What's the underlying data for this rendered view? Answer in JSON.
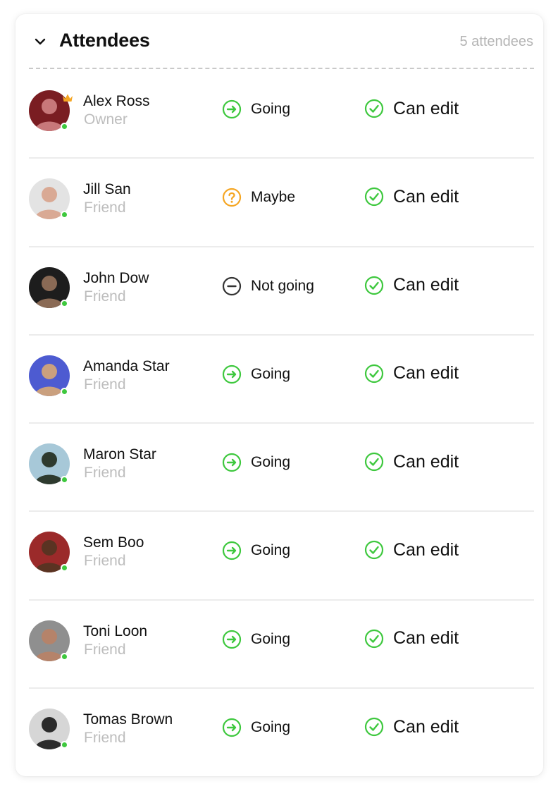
{
  "header": {
    "title": "Attendees",
    "count_label": "5 attendees"
  },
  "colors": {
    "going": "#3ec83e",
    "maybe": "#f5a623",
    "not_going": "#333333",
    "online": "#3ec83e"
  },
  "attendees": [
    {
      "name": "Alex Ross",
      "role": "Owner",
      "status": "Going",
      "status_icon": "arrow-right-circle-icon",
      "permission": "Can edit",
      "owner": true,
      "avatar_colors": [
        "#7a1d22",
        "#c8787a"
      ]
    },
    {
      "name": "Jill San",
      "role": "Friend",
      "status": "Maybe",
      "status_icon": "question-circle-icon",
      "permission": "Can edit",
      "owner": false,
      "avatar_colors": [
        "#e3e3e3",
        "#d9a994"
      ]
    },
    {
      "name": "John Dow",
      "role": "Friend",
      "status": "Not going",
      "status_icon": "minus-circle-icon",
      "permission": "Can edit",
      "owner": false,
      "avatar_colors": [
        "#1d1d1d",
        "#8a6a55"
      ]
    },
    {
      "name": "Amanda Star",
      "role": "Friend",
      "status": "Going",
      "status_icon": "arrow-right-circle-icon",
      "permission": "Can edit",
      "owner": false,
      "avatar_colors": [
        "#4d5bd1",
        "#caa07e"
      ]
    },
    {
      "name": "Maron Star",
      "role": "Friend",
      "status": "Going",
      "status_icon": "arrow-right-circle-icon",
      "permission": "Can edit",
      "owner": false,
      "avatar_colors": [
        "#a7c8d8",
        "#2e3a2e"
      ]
    },
    {
      "name": "Sem Boo",
      "role": "Friend",
      "status": "Going",
      "status_icon": "arrow-right-circle-icon",
      "permission": "Can edit",
      "owner": false,
      "avatar_colors": [
        "#9b2a2a",
        "#5a3322"
      ]
    },
    {
      "name": "Toni Loon",
      "role": "Friend",
      "status": "Going",
      "status_icon": "arrow-right-circle-icon",
      "permission": "Can edit",
      "owner": false,
      "avatar_colors": [
        "#8f8f8f",
        "#b5836a"
      ]
    },
    {
      "name": "Tomas Brown",
      "role": "Friend",
      "status": "Going",
      "status_icon": "arrow-right-circle-icon",
      "permission": "Can edit",
      "owner": false,
      "avatar_colors": [
        "#d6d6d6",
        "#2b2b2b"
      ]
    }
  ]
}
